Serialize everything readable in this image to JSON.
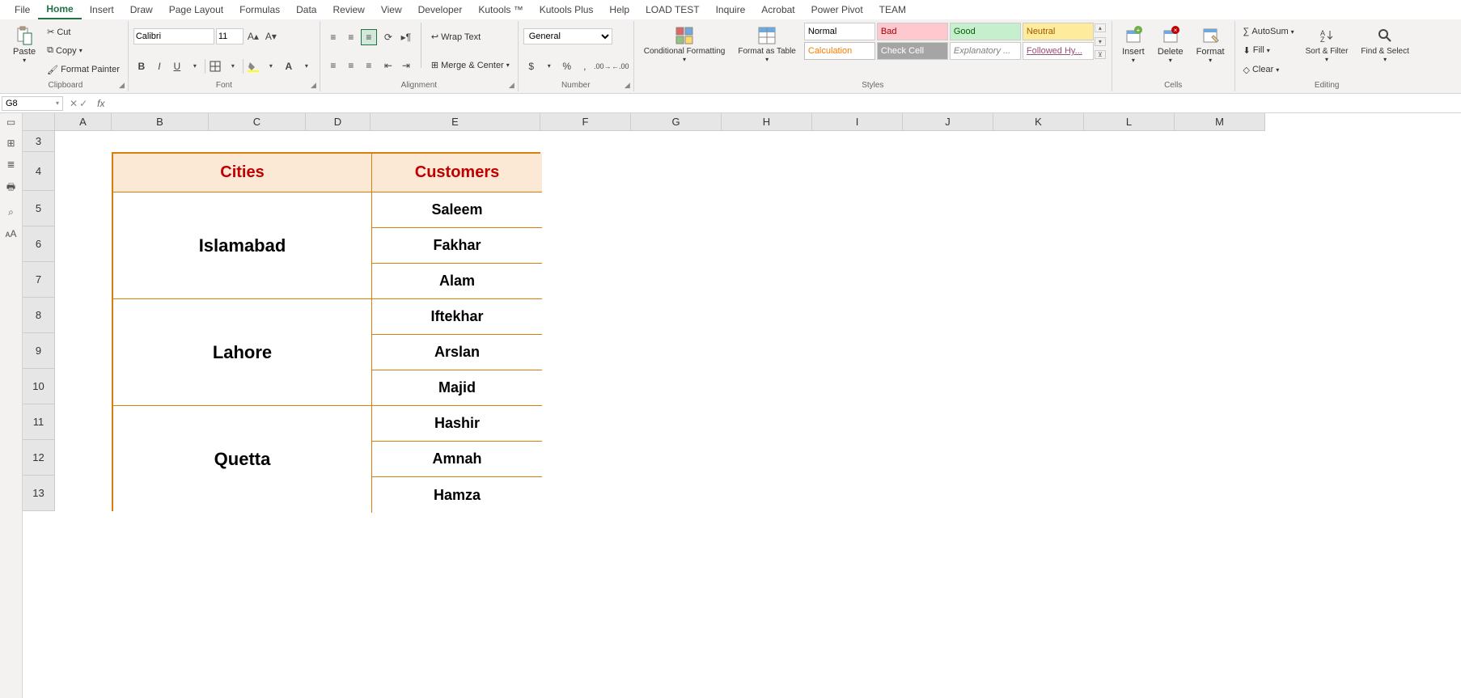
{
  "tabs": [
    "File",
    "Home",
    "Insert",
    "Draw",
    "Page Layout",
    "Formulas",
    "Data",
    "Review",
    "View",
    "Developer",
    "Kutools ™",
    "Kutools Plus",
    "Help",
    "LOAD TEST",
    "Inquire",
    "Acrobat",
    "Power Pivot",
    "TEAM"
  ],
  "active_tab": "Home",
  "clipboard": {
    "paste": "Paste",
    "cut": "Cut",
    "copy": "Copy",
    "format_painter": "Format Painter",
    "group_label": "Clipboard"
  },
  "font": {
    "name": "Calibri",
    "size": "11",
    "group_label": "Font"
  },
  "alignment": {
    "wrap": "Wrap Text",
    "merge": "Merge & Center",
    "group_label": "Alignment"
  },
  "number": {
    "format": "General",
    "group_label": "Number"
  },
  "styles_group": {
    "cond": "Conditional Formatting",
    "table": "Format as Table",
    "group_label": "Styles"
  },
  "style_cells": [
    "Normal",
    "Bad",
    "Good",
    "Neutral",
    "Calculation",
    "Check Cell",
    "Explanatory ...",
    "Followed Hy..."
  ],
  "cells_group": {
    "insert": "Insert",
    "delete": "Delete",
    "format": "Format",
    "group_label": "Cells"
  },
  "editing": {
    "autosum": "AutoSum",
    "fill": "Fill",
    "clear": "Clear",
    "sort": "Sort & Filter",
    "find": "Find & Select",
    "group_label": "Editing"
  },
  "name_box": "G8",
  "formula": "",
  "columns": {
    "A": 70,
    "B": 120,
    "C": 120,
    "D": 80,
    "E": 210,
    "F": 112,
    "G": 112,
    "H": 112,
    "I": 112,
    "J": 112,
    "K": 112,
    "L": 112,
    "M": 112
  },
  "rows": [
    3,
    4,
    5,
    6,
    7,
    8,
    9,
    10,
    11,
    12,
    13
  ],
  "row_heights": {
    "3": 26,
    "4": 48,
    "5": 44,
    "6": 44,
    "7": 44,
    "8": 44,
    "9": 44,
    "10": 44,
    "11": 44,
    "12": 44,
    "13": 44
  },
  "table": {
    "header_cities": "Cities",
    "header_customers": "Customers",
    "groups": [
      {
        "city": "Islamabad",
        "customers": [
          "Saleem",
          "Fakhar",
          "Alam"
        ]
      },
      {
        "city": "Lahore",
        "customers": [
          "Iftekhar",
          "Arslan",
          "Majid"
        ]
      },
      {
        "city": "Quetta",
        "customers": [
          "Hashir",
          "Amnah",
          "Hamza"
        ]
      }
    ]
  }
}
